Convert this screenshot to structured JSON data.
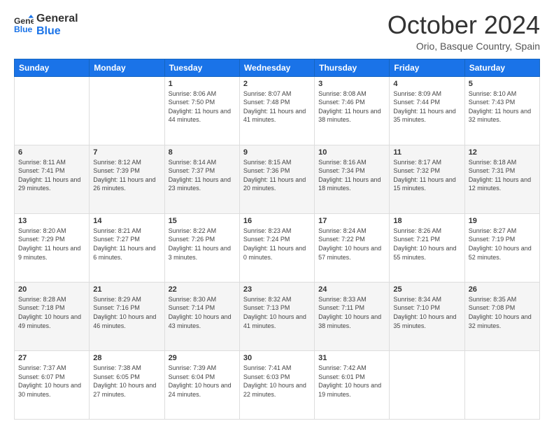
{
  "logo": {
    "line1": "General",
    "line2": "Blue"
  },
  "header": {
    "month": "October 2024",
    "location": "Orio, Basque Country, Spain"
  },
  "weekdays": [
    "Sunday",
    "Monday",
    "Tuesday",
    "Wednesday",
    "Thursday",
    "Friday",
    "Saturday"
  ],
  "weeks": [
    [
      {
        "day": "",
        "sunrise": "",
        "sunset": "",
        "daylight": ""
      },
      {
        "day": "",
        "sunrise": "",
        "sunset": "",
        "daylight": ""
      },
      {
        "day": "1",
        "sunrise": "Sunrise: 8:06 AM",
        "sunset": "Sunset: 7:50 PM",
        "daylight": "Daylight: 11 hours and 44 minutes."
      },
      {
        "day": "2",
        "sunrise": "Sunrise: 8:07 AM",
        "sunset": "Sunset: 7:48 PM",
        "daylight": "Daylight: 11 hours and 41 minutes."
      },
      {
        "day": "3",
        "sunrise": "Sunrise: 8:08 AM",
        "sunset": "Sunset: 7:46 PM",
        "daylight": "Daylight: 11 hours and 38 minutes."
      },
      {
        "day": "4",
        "sunrise": "Sunrise: 8:09 AM",
        "sunset": "Sunset: 7:44 PM",
        "daylight": "Daylight: 11 hours and 35 minutes."
      },
      {
        "day": "5",
        "sunrise": "Sunrise: 8:10 AM",
        "sunset": "Sunset: 7:43 PM",
        "daylight": "Daylight: 11 hours and 32 minutes."
      }
    ],
    [
      {
        "day": "6",
        "sunrise": "Sunrise: 8:11 AM",
        "sunset": "Sunset: 7:41 PM",
        "daylight": "Daylight: 11 hours and 29 minutes."
      },
      {
        "day": "7",
        "sunrise": "Sunrise: 8:12 AM",
        "sunset": "Sunset: 7:39 PM",
        "daylight": "Daylight: 11 hours and 26 minutes."
      },
      {
        "day": "8",
        "sunrise": "Sunrise: 8:14 AM",
        "sunset": "Sunset: 7:37 PM",
        "daylight": "Daylight: 11 hours and 23 minutes."
      },
      {
        "day": "9",
        "sunrise": "Sunrise: 8:15 AM",
        "sunset": "Sunset: 7:36 PM",
        "daylight": "Daylight: 11 hours and 20 minutes."
      },
      {
        "day": "10",
        "sunrise": "Sunrise: 8:16 AM",
        "sunset": "Sunset: 7:34 PM",
        "daylight": "Daylight: 11 hours and 18 minutes."
      },
      {
        "day": "11",
        "sunrise": "Sunrise: 8:17 AM",
        "sunset": "Sunset: 7:32 PM",
        "daylight": "Daylight: 11 hours and 15 minutes."
      },
      {
        "day": "12",
        "sunrise": "Sunrise: 8:18 AM",
        "sunset": "Sunset: 7:31 PM",
        "daylight": "Daylight: 11 hours and 12 minutes."
      }
    ],
    [
      {
        "day": "13",
        "sunrise": "Sunrise: 8:20 AM",
        "sunset": "Sunset: 7:29 PM",
        "daylight": "Daylight: 11 hours and 9 minutes."
      },
      {
        "day": "14",
        "sunrise": "Sunrise: 8:21 AM",
        "sunset": "Sunset: 7:27 PM",
        "daylight": "Daylight: 11 hours and 6 minutes."
      },
      {
        "day": "15",
        "sunrise": "Sunrise: 8:22 AM",
        "sunset": "Sunset: 7:26 PM",
        "daylight": "Daylight: 11 hours and 3 minutes."
      },
      {
        "day": "16",
        "sunrise": "Sunrise: 8:23 AM",
        "sunset": "Sunset: 7:24 PM",
        "daylight": "Daylight: 11 hours and 0 minutes."
      },
      {
        "day": "17",
        "sunrise": "Sunrise: 8:24 AM",
        "sunset": "Sunset: 7:22 PM",
        "daylight": "Daylight: 10 hours and 57 minutes."
      },
      {
        "day": "18",
        "sunrise": "Sunrise: 8:26 AM",
        "sunset": "Sunset: 7:21 PM",
        "daylight": "Daylight: 10 hours and 55 minutes."
      },
      {
        "day": "19",
        "sunrise": "Sunrise: 8:27 AM",
        "sunset": "Sunset: 7:19 PM",
        "daylight": "Daylight: 10 hours and 52 minutes."
      }
    ],
    [
      {
        "day": "20",
        "sunrise": "Sunrise: 8:28 AM",
        "sunset": "Sunset: 7:18 PM",
        "daylight": "Daylight: 10 hours and 49 minutes."
      },
      {
        "day": "21",
        "sunrise": "Sunrise: 8:29 AM",
        "sunset": "Sunset: 7:16 PM",
        "daylight": "Daylight: 10 hours and 46 minutes."
      },
      {
        "day": "22",
        "sunrise": "Sunrise: 8:30 AM",
        "sunset": "Sunset: 7:14 PM",
        "daylight": "Daylight: 10 hours and 43 minutes."
      },
      {
        "day": "23",
        "sunrise": "Sunrise: 8:32 AM",
        "sunset": "Sunset: 7:13 PM",
        "daylight": "Daylight: 10 hours and 41 minutes."
      },
      {
        "day": "24",
        "sunrise": "Sunrise: 8:33 AM",
        "sunset": "Sunset: 7:11 PM",
        "daylight": "Daylight: 10 hours and 38 minutes."
      },
      {
        "day": "25",
        "sunrise": "Sunrise: 8:34 AM",
        "sunset": "Sunset: 7:10 PM",
        "daylight": "Daylight: 10 hours and 35 minutes."
      },
      {
        "day": "26",
        "sunrise": "Sunrise: 8:35 AM",
        "sunset": "Sunset: 7:08 PM",
        "daylight": "Daylight: 10 hours and 32 minutes."
      }
    ],
    [
      {
        "day": "27",
        "sunrise": "Sunrise: 7:37 AM",
        "sunset": "Sunset: 6:07 PM",
        "daylight": "Daylight: 10 hours and 30 minutes."
      },
      {
        "day": "28",
        "sunrise": "Sunrise: 7:38 AM",
        "sunset": "Sunset: 6:05 PM",
        "daylight": "Daylight: 10 hours and 27 minutes."
      },
      {
        "day": "29",
        "sunrise": "Sunrise: 7:39 AM",
        "sunset": "Sunset: 6:04 PM",
        "daylight": "Daylight: 10 hours and 24 minutes."
      },
      {
        "day": "30",
        "sunrise": "Sunrise: 7:41 AM",
        "sunset": "Sunset: 6:03 PM",
        "daylight": "Daylight: 10 hours and 22 minutes."
      },
      {
        "day": "31",
        "sunrise": "Sunrise: 7:42 AM",
        "sunset": "Sunset: 6:01 PM",
        "daylight": "Daylight: 10 hours and 19 minutes."
      },
      {
        "day": "",
        "sunrise": "",
        "sunset": "",
        "daylight": ""
      },
      {
        "day": "",
        "sunrise": "",
        "sunset": "",
        "daylight": ""
      }
    ]
  ]
}
